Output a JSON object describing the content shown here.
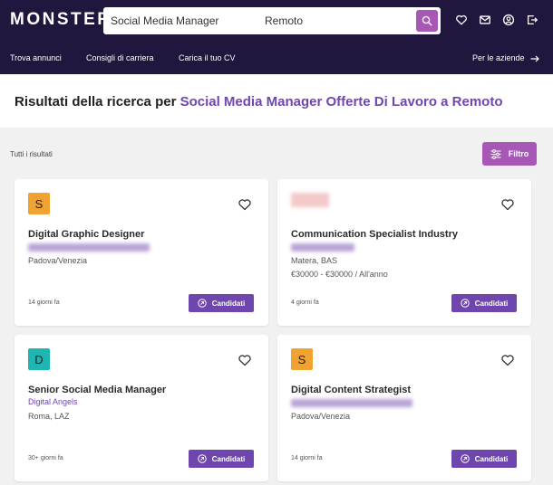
{
  "header": {
    "logo": "MONSTER",
    "search_query": "Social Media Manager",
    "search_location": "Remoto",
    "nav": [
      "Trova annunci",
      "Consigli di carriera",
      "Carica il tuo CV"
    ],
    "nav_right": "Per le aziende"
  },
  "page": {
    "title_prefix": "Risultati della ricerca per ",
    "title_highlight": "Social Media Manager Offerte Di Lavoro a Remoto",
    "results_label": "Tutti i risultati",
    "filter_label": "Filtro"
  },
  "colors": {
    "header_bg": "#21163d",
    "accent_pink": "#a757b5",
    "accent_purple": "#6e46ae"
  },
  "jobs": [
    {
      "badge": "S",
      "badge_color": "#f0a332",
      "title": "Digital Graphic Designer",
      "company": "",
      "location": "Padova/Venezia",
      "salary": "",
      "age": "14 giorni fa",
      "apply": "Candidati"
    },
    {
      "badge": "",
      "badge_color": "",
      "title": "Communication Specialist Industry",
      "company": "",
      "location": "Matera, BAS",
      "salary": "€30000 - €30000 / All'anno",
      "age": "4 giorni fa",
      "apply": "Candidati"
    },
    {
      "badge": "D",
      "badge_color": "#1fb5b0",
      "title": "Senior Social Media Manager",
      "company": "Digital Angels",
      "location": "Roma, LAZ",
      "salary": "",
      "age": "30+ giorni fa",
      "apply": "Candidati"
    },
    {
      "badge": "S",
      "badge_color": "#f0a332",
      "title": "Digital Content Strategist",
      "company": "",
      "location": "Padova/Venezia",
      "salary": "",
      "age": "14 giorni fa",
      "apply": "Candidati"
    }
  ]
}
